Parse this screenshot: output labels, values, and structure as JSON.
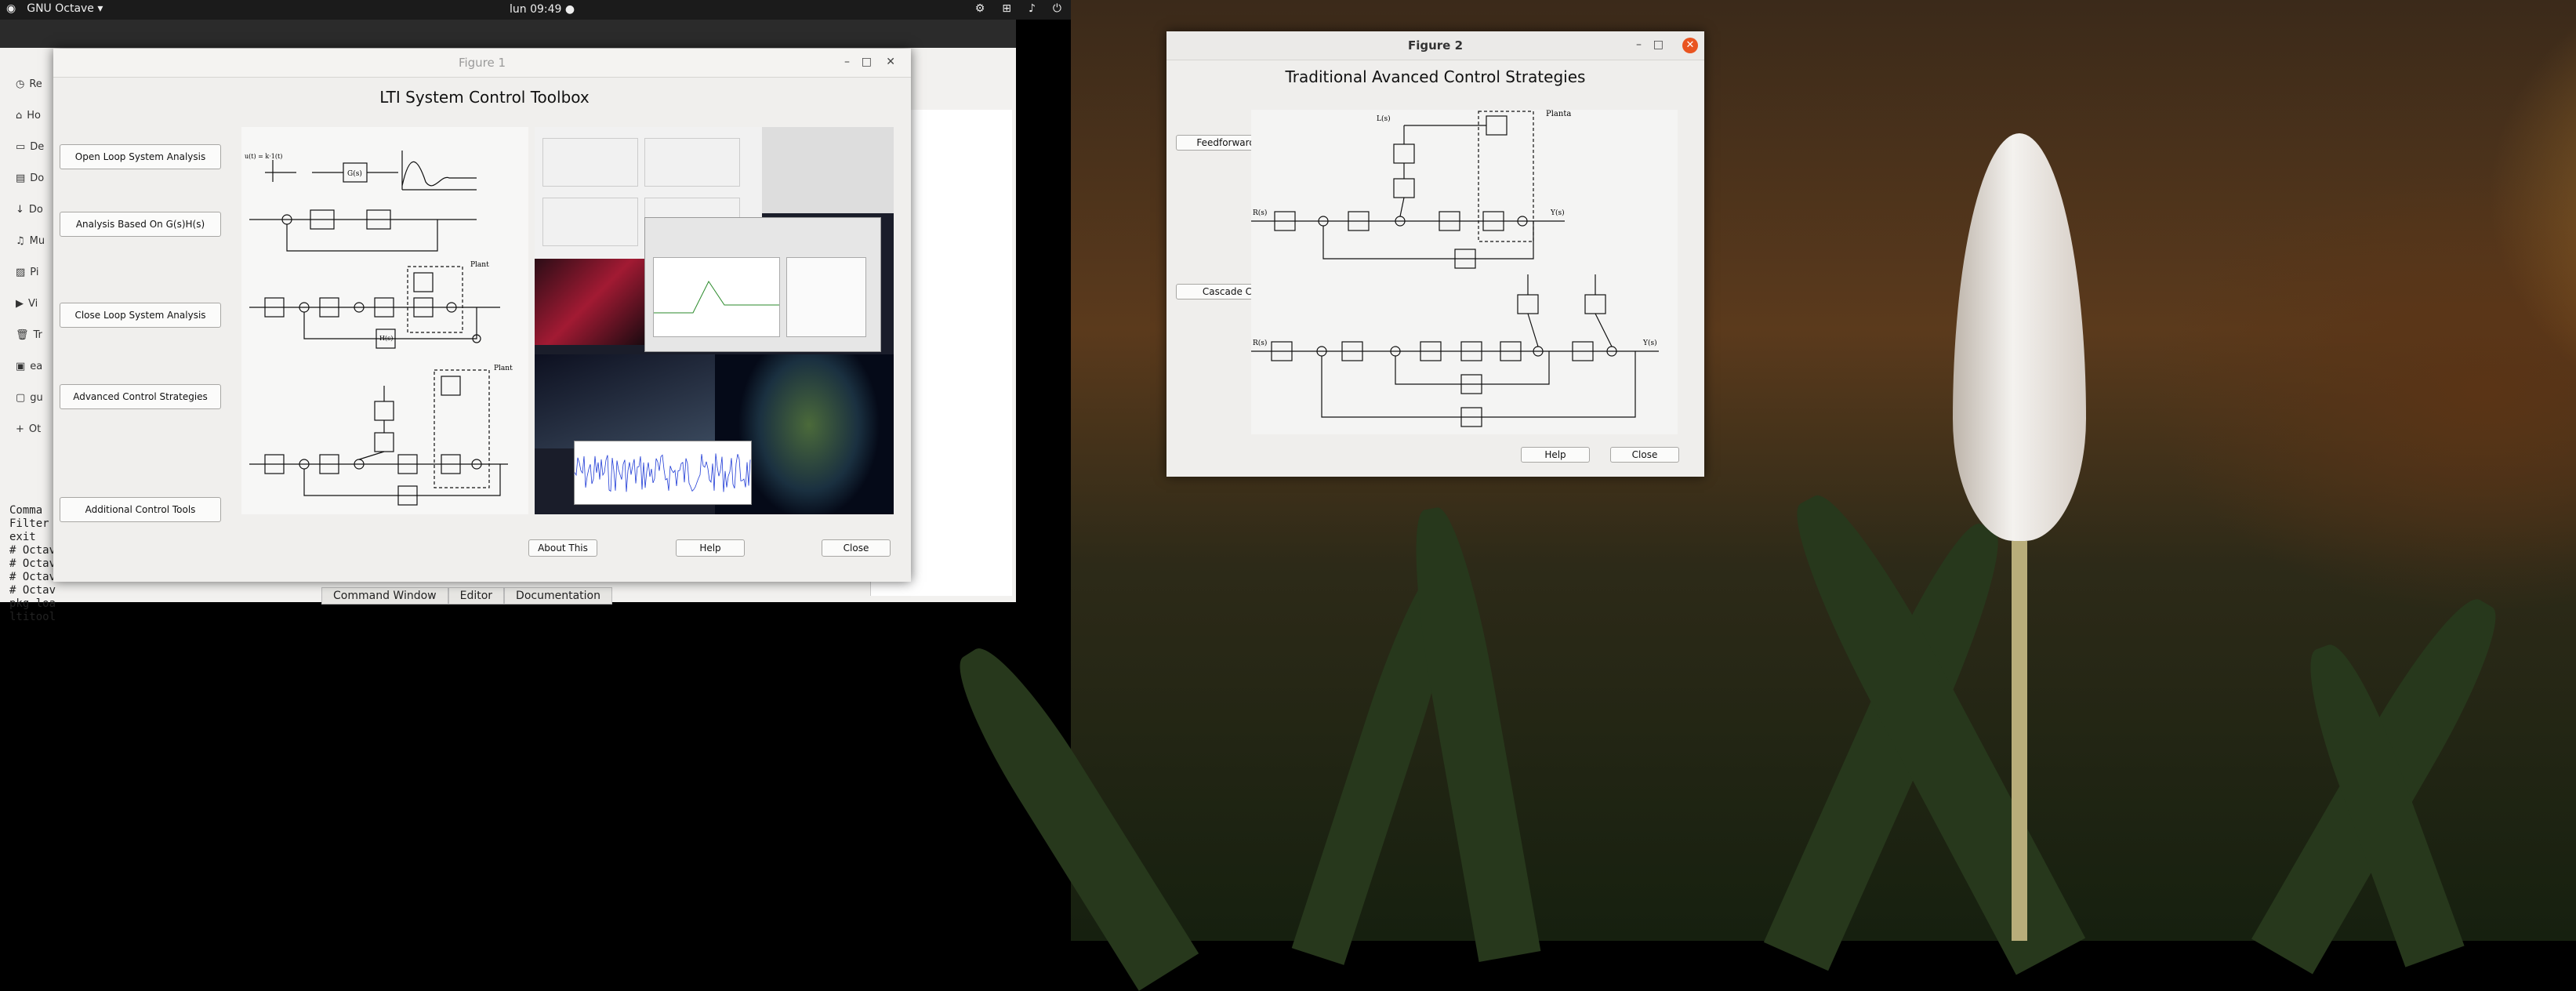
{
  "topbar": {
    "app_name": "GNU Octave",
    "clock": "lun 09:49 ●"
  },
  "octave_main": {
    "sidebar_items": [
      "Re",
      "Ho",
      "De",
      "Do",
      "Do",
      "Mu",
      "Pi",
      "Vi",
      "Tr",
      "ea",
      "gu",
      "Ot"
    ],
    "command_label": "Comma",
    "filter_label": "Filter",
    "history": [
      "exit",
      "# Octav",
      "# Octav",
      "# Octav",
      "# Octav",
      "pkg loa",
      "ltitool"
    ],
    "tabs": [
      "Command Window",
      "Editor",
      "Documentation"
    ]
  },
  "figure1": {
    "window_title": "Figure 1",
    "heading": "LTI System Control Toolbox",
    "buttons": [
      "Open Loop System Analysis",
      "Analysis Based On G(s)H(s)",
      "Close Loop System Analysis",
      "Advanced Control Strategies",
      "Additional Control Tools"
    ],
    "bottom_buttons": {
      "about": "About This",
      "help": "Help",
      "close": "Close"
    },
    "diagram_labels": {
      "step": "u(t) = k·1(t)",
      "g": "G(s)",
      "plant": "Plant",
      "h": "H(s)"
    }
  },
  "figure2": {
    "window_title": "Figure 2",
    "heading": "Traditional Avanced Control Strategies",
    "buttons": {
      "feedforward": "Feedforward-Feedback Control",
      "cascade": "Cascade Control",
      "help": "Help",
      "close": "Close"
    },
    "diagram_labels": {
      "planta": "Planta",
      "r": "R(s)",
      "y": "Y(s)",
      "l": "L(s)"
    }
  }
}
